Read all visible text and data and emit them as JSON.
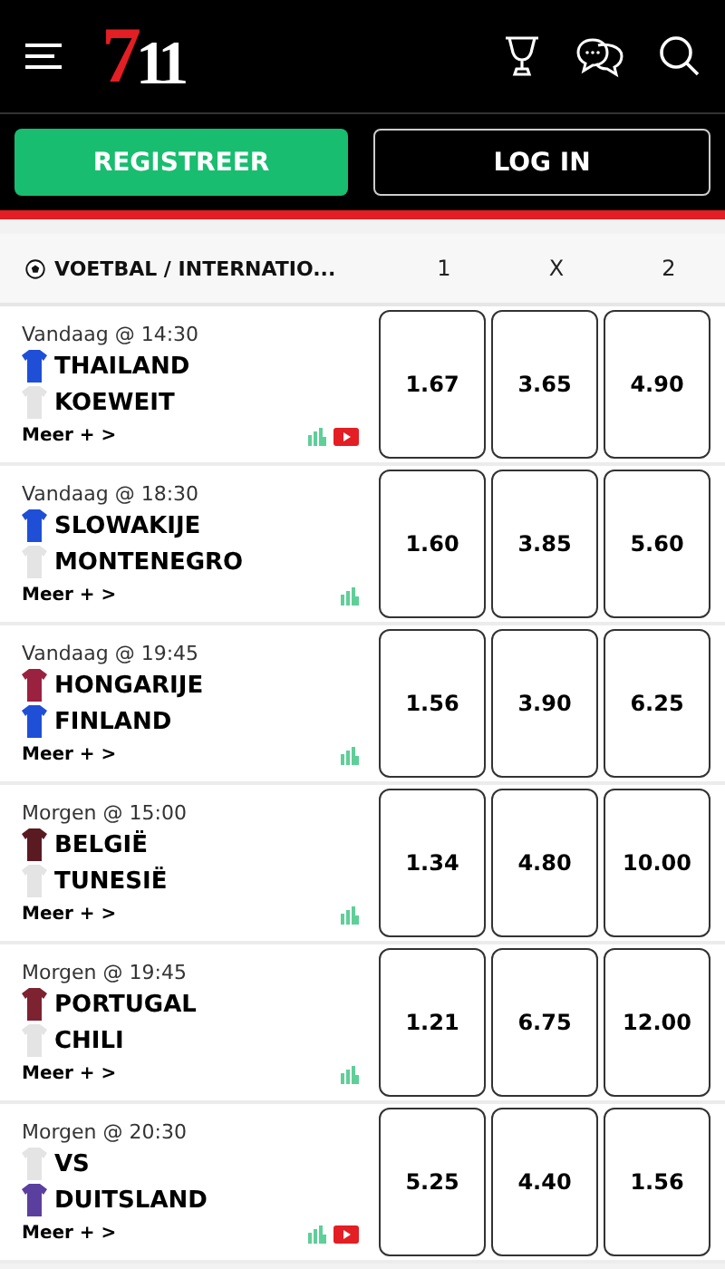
{
  "header": {
    "logo_first": "7",
    "logo_rest": "11"
  },
  "auth": {
    "register": "REGISTREER",
    "login": "LOG IN"
  },
  "market": {
    "title": "VOETBAL / INTERNATIO...",
    "columns": [
      "1",
      "X",
      "2"
    ]
  },
  "matches": [
    {
      "time": "Vandaag @ 14:30",
      "teams": [
        {
          "name": "THAILAND",
          "color": "#1f4fd6"
        },
        {
          "name": "KOEWEIT",
          "color": "#e4e4e4"
        }
      ],
      "more": "Meer + >",
      "video": true,
      "odds": [
        "1.67",
        "3.65",
        "4.90"
      ]
    },
    {
      "time": "Vandaag @ 18:30",
      "teams": [
        {
          "name": "SLOWAKIJE",
          "color": "#1f4fd6"
        },
        {
          "name": "MONTENEGRO",
          "color": "#e4e4e4"
        }
      ],
      "more": "Meer + >",
      "video": false,
      "odds": [
        "1.60",
        "3.85",
        "5.60"
      ]
    },
    {
      "time": "Vandaag @ 19:45",
      "teams": [
        {
          "name": "HONGARIJE",
          "color": "#9a2140"
        },
        {
          "name": "FINLAND",
          "color": "#1f4fd6"
        }
      ],
      "more": "Meer + >",
      "video": false,
      "odds": [
        "1.56",
        "3.90",
        "6.25"
      ]
    },
    {
      "time": "Morgen @ 15:00",
      "teams": [
        {
          "name": "BELGIË",
          "color": "#5a1a22"
        },
        {
          "name": "TUNESIË",
          "color": "#e4e4e4"
        }
      ],
      "more": "Meer + >",
      "video": false,
      "odds": [
        "1.34",
        "4.80",
        "10.00"
      ]
    },
    {
      "time": "Morgen @ 19:45",
      "teams": [
        {
          "name": "PORTUGAL",
          "color": "#7d2230"
        },
        {
          "name": "CHILI",
          "color": "#e4e4e4"
        }
      ],
      "more": "Meer + >",
      "video": false,
      "odds": [
        "1.21",
        "6.75",
        "12.00"
      ]
    },
    {
      "time": "Morgen @ 20:30",
      "teams": [
        {
          "name": "VS",
          "color": "#e4e4e4"
        },
        {
          "name": "DUITSLAND",
          "color": "#5b3f9e"
        }
      ],
      "more": "Meer + >",
      "video": true,
      "odds": [
        "5.25",
        "4.40",
        "1.56"
      ]
    }
  ]
}
